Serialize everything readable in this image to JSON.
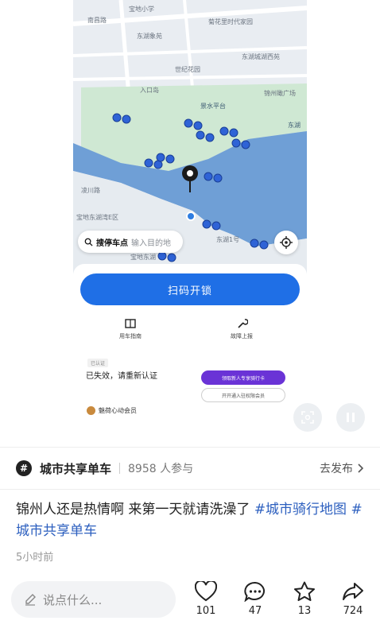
{
  "map": {
    "labels": [
      "南昌路",
      "宝地小学",
      "菊花里时代家园",
      "东湖象苑",
      "东湖城湖西苑",
      "世纪花园",
      "入口岛",
      "锦州瞰广场",
      "景水平台",
      "东湖",
      "凌川路",
      "宝地东湖湾E区",
      "东湖1号",
      "宝地东湖"
    ],
    "search_keyword": "搜停车点",
    "search_placeholder": "输入目的地"
  },
  "app_panel": {
    "scan_button": "扫码开锁",
    "tools": [
      {
        "label": "用车指南",
        "icon": "guide-icon"
      },
      {
        "label": "故障上报",
        "icon": "wrench-icon"
      }
    ],
    "chip": "已认证",
    "expired_text": "已失效，请重新认证",
    "purple_button": "领取新人专享骑行卡",
    "outline_button": "开开通入驻权限会员",
    "member_label": "魅荷心动会员"
  },
  "topic": {
    "icon": "#",
    "name": "城市共享单车",
    "count": "8958 人参与",
    "action": "去发布"
  },
  "post": {
    "text": "锦州人还是热情啊 来第一天就请洗澡了",
    "tags": [
      "#城市骑行地图",
      "#城市共享单车"
    ],
    "time": "5小时前"
  },
  "actions": {
    "comment_placeholder": "说点什么...",
    "likes": "101",
    "comments": "47",
    "favorites": "13",
    "shares": "724"
  },
  "colors": {
    "accent": "#1f6fe6",
    "purple": "#6a33d6",
    "water": "#6f9fd6",
    "park": "#cfe8d3",
    "tag": "#2c5fbf"
  }
}
